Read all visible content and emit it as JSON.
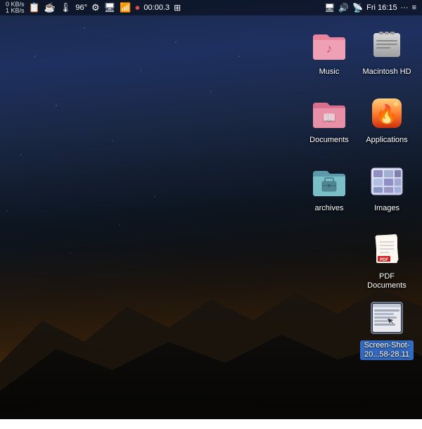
{
  "menubar": {
    "left_items": [
      {
        "label": "0 KB/s",
        "id": "net-up"
      },
      {
        "label": "1 KB/s",
        "id": "net-down"
      }
    ],
    "status_icons": [
      "battery-icon",
      "brightness-icon",
      "temp-icon",
      "cpu-icon",
      "display-icon",
      "wifi-icon",
      "record-icon"
    ],
    "timer": "00:00.3",
    "right_icons": [
      "monitor-icon",
      "volume-icon",
      "airdrop-icon"
    ],
    "time": "Fri 16:15",
    "more": "···",
    "list_icon": "≡"
  },
  "desktop_icons": [
    {
      "id": "music",
      "label": "Music",
      "col": 1,
      "row": 1,
      "type": "folder-pink",
      "has_music_note": true
    },
    {
      "id": "macintosh-hd",
      "label": "Macintosh HD",
      "col": 2,
      "row": 1,
      "type": "hard-drive"
    },
    {
      "id": "documents",
      "label": "Documents",
      "col": 1,
      "row": 2,
      "type": "folder-pink",
      "has_book": true
    },
    {
      "id": "applications",
      "label": "Applications",
      "col": 2,
      "row": 2,
      "type": "applications"
    },
    {
      "id": "archives",
      "label": "archives",
      "col": 1,
      "row": 3,
      "type": "folder-teal",
      "has_briefcase": true
    },
    {
      "id": "images",
      "label": "Images",
      "col": 2,
      "row": 3,
      "type": "images"
    },
    {
      "id": "pdf-documents",
      "label": "PDF Documents",
      "col": 2,
      "row": 4,
      "type": "pdf"
    },
    {
      "id": "screenshot",
      "label": "Screen-Shot-20...58-28.11",
      "col": 2,
      "row": 5,
      "type": "screenshot",
      "selected": true
    }
  ]
}
